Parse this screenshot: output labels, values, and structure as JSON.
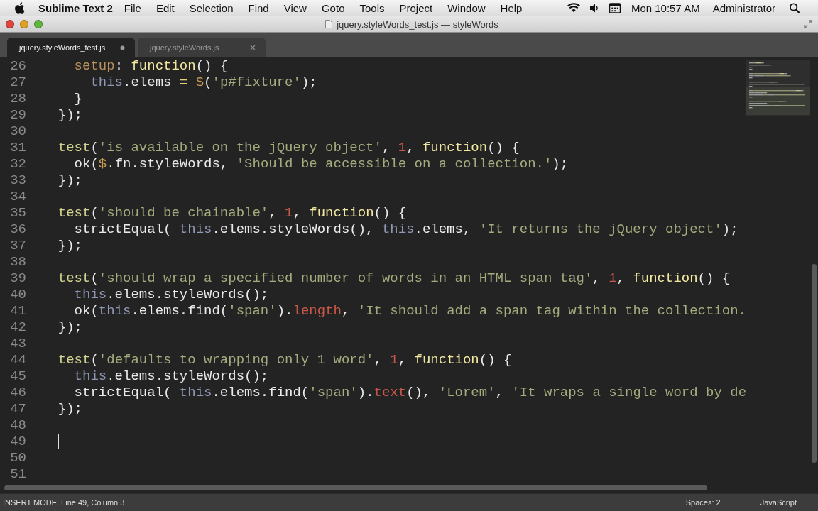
{
  "menu_bar": {
    "app_name": "Sublime Text 2",
    "menus": [
      "File",
      "Edit",
      "Selection",
      "Find",
      "View",
      "Goto",
      "Tools",
      "Project",
      "Window",
      "Help"
    ],
    "clock": "Mon 10:57 AM",
    "user": "Administrator"
  },
  "window": {
    "title": "jquery.styleWords_test.js — styleWords"
  },
  "tabs": [
    {
      "label": "jquery.styleWords_test.js",
      "selected": true,
      "modified": true
    },
    {
      "label": "jquery.styleWords.js",
      "selected": false,
      "modified": false
    }
  ],
  "editor": {
    "lines": [
      {
        "number": "26",
        "cursor": false,
        "tokens": [
          {
            "kind": "key",
            "text": "    setup"
          },
          {
            "kind": "plain",
            "text": ": "
          },
          {
            "kind": "fn",
            "text": "function"
          },
          {
            "kind": "plain",
            "text": "() {"
          }
        ]
      },
      {
        "number": "27",
        "cursor": false,
        "tokens": [
          {
            "kind": "this",
            "text": "      this"
          },
          {
            "kind": "plain",
            "text": ".elems "
          },
          {
            "kind": "op",
            "text": "="
          },
          {
            "kind": "dollar",
            "text": " $"
          },
          {
            "kind": "plain",
            "text": "("
          },
          {
            "kind": "str",
            "text": "'p#fixture'"
          },
          {
            "kind": "plain",
            "text": ");"
          }
        ]
      },
      {
        "number": "28",
        "cursor": false,
        "tokens": [
          {
            "kind": "plain",
            "text": "    }"
          }
        ]
      },
      {
        "number": "29",
        "cursor": false,
        "tokens": [
          {
            "kind": "plain",
            "text": "  });"
          }
        ]
      },
      {
        "number": "30",
        "cursor": false
      },
      {
        "number": "31",
        "cursor": false,
        "tokens": [
          {
            "kind": "call",
            "text": "  test"
          },
          {
            "kind": "plain",
            "text": "("
          },
          {
            "kind": "str",
            "text": "'is available on the jQuery object'"
          },
          {
            "kind": "plain",
            "text": ", "
          },
          {
            "kind": "num",
            "text": "1"
          },
          {
            "kind": "plain",
            "text": ", "
          },
          {
            "kind": "fn",
            "text": "function"
          },
          {
            "kind": "plain",
            "text": "() {"
          }
        ]
      },
      {
        "number": "32",
        "cursor": false,
        "tokens": [
          {
            "kind": "plain",
            "text": "    ok("
          },
          {
            "kind": "dollar",
            "text": "$"
          },
          {
            "kind": "plain",
            "text": ".fn.styleWords, "
          },
          {
            "kind": "str",
            "text": "'Should be accessible on a collection.'"
          },
          {
            "kind": "plain",
            "text": ");"
          }
        ]
      },
      {
        "number": "33",
        "cursor": false,
        "tokens": [
          {
            "kind": "plain",
            "text": "  });"
          }
        ]
      },
      {
        "number": "34",
        "cursor": false
      },
      {
        "number": "35",
        "cursor": false,
        "tokens": [
          {
            "kind": "call",
            "text": "  test"
          },
          {
            "kind": "plain",
            "text": "("
          },
          {
            "kind": "str",
            "text": "'should be chainable'"
          },
          {
            "kind": "plain",
            "text": ", "
          },
          {
            "kind": "num",
            "text": "1"
          },
          {
            "kind": "plain",
            "text": ", "
          },
          {
            "kind": "fn",
            "text": "function"
          },
          {
            "kind": "plain",
            "text": "() {"
          }
        ]
      },
      {
        "number": "36",
        "cursor": false,
        "tokens": [
          {
            "kind": "plain",
            "text": "    strictEqual( "
          },
          {
            "kind": "this",
            "text": "this"
          },
          {
            "kind": "plain",
            "text": ".elems.styleWords(), "
          },
          {
            "kind": "this",
            "text": "this"
          },
          {
            "kind": "plain",
            "text": ".elems, "
          },
          {
            "kind": "str",
            "text": "'It returns the jQuery object'"
          },
          {
            "kind": "plain",
            "text": ");"
          }
        ]
      },
      {
        "number": "37",
        "cursor": false,
        "tokens": [
          {
            "kind": "plain",
            "text": "  });"
          }
        ]
      },
      {
        "number": "38",
        "cursor": false
      },
      {
        "number": "39",
        "cursor": false,
        "tokens": [
          {
            "kind": "call",
            "text": "  test"
          },
          {
            "kind": "plain",
            "text": "("
          },
          {
            "kind": "str",
            "text": "'should wrap a specified number of words in an HTML span tag'"
          },
          {
            "kind": "plain",
            "text": ", "
          },
          {
            "kind": "num",
            "text": "1"
          },
          {
            "kind": "plain",
            "text": ", "
          },
          {
            "kind": "fn",
            "text": "function"
          },
          {
            "kind": "plain",
            "text": "() {"
          }
        ]
      },
      {
        "number": "40",
        "cursor": false,
        "tokens": [
          {
            "kind": "this",
            "text": "    this"
          },
          {
            "kind": "plain",
            "text": ".elems.styleWords();"
          }
        ]
      },
      {
        "number": "41",
        "cursor": false,
        "tokens": [
          {
            "kind": "plain",
            "text": "    ok("
          },
          {
            "kind": "this",
            "text": "this"
          },
          {
            "kind": "plain",
            "text": ".elems.find("
          },
          {
            "kind": "str",
            "text": "'span'"
          },
          {
            "kind": "plain",
            "text": ")."
          },
          {
            "kind": "prop",
            "text": "length"
          },
          {
            "kind": "plain",
            "text": ", "
          },
          {
            "kind": "str",
            "text": "'It should add a span tag within the collection."
          }
        ]
      },
      {
        "number": "42",
        "cursor": false,
        "tokens": [
          {
            "kind": "plain",
            "text": "  });"
          }
        ]
      },
      {
        "number": "43",
        "cursor": false
      },
      {
        "number": "44",
        "cursor": false,
        "tokens": [
          {
            "kind": "call",
            "text": "  test"
          },
          {
            "kind": "plain",
            "text": "("
          },
          {
            "kind": "str",
            "text": "'defaults to wrapping only 1 word'"
          },
          {
            "kind": "plain",
            "text": ", "
          },
          {
            "kind": "num",
            "text": "1"
          },
          {
            "kind": "plain",
            "text": ", "
          },
          {
            "kind": "fn",
            "text": "function"
          },
          {
            "kind": "plain",
            "text": "() {"
          }
        ]
      },
      {
        "number": "45",
        "cursor": false,
        "tokens": [
          {
            "kind": "this",
            "text": "    this"
          },
          {
            "kind": "plain",
            "text": ".elems.styleWords();"
          }
        ]
      },
      {
        "number": "46",
        "cursor": false,
        "tokens": [
          {
            "kind": "plain",
            "text": "    strictEqual( "
          },
          {
            "kind": "this",
            "text": "this"
          },
          {
            "kind": "plain",
            "text": ".elems.find("
          },
          {
            "kind": "str",
            "text": "'span'"
          },
          {
            "kind": "plain",
            "text": ")."
          },
          {
            "kind": "prop",
            "text": "text"
          },
          {
            "kind": "plain",
            "text": "(), "
          },
          {
            "kind": "str",
            "text": "'Lorem'"
          },
          {
            "kind": "plain",
            "text": ", "
          },
          {
            "kind": "str",
            "text": "'It wraps a single word by de"
          }
        ]
      },
      {
        "number": "47",
        "cursor": false,
        "tokens": [
          {
            "kind": "plain",
            "text": "  });"
          }
        ]
      },
      {
        "number": "48",
        "cursor": false
      },
      {
        "number": "49",
        "cursor": true
      },
      {
        "number": "50",
        "cursor": false
      },
      {
        "number": "51",
        "cursor": false
      }
    ]
  },
  "status_bar": {
    "mode": "INSERT MODE, Line 49, Column 3",
    "indentation": "Spaces: 2",
    "syntax": "JavaScript"
  }
}
